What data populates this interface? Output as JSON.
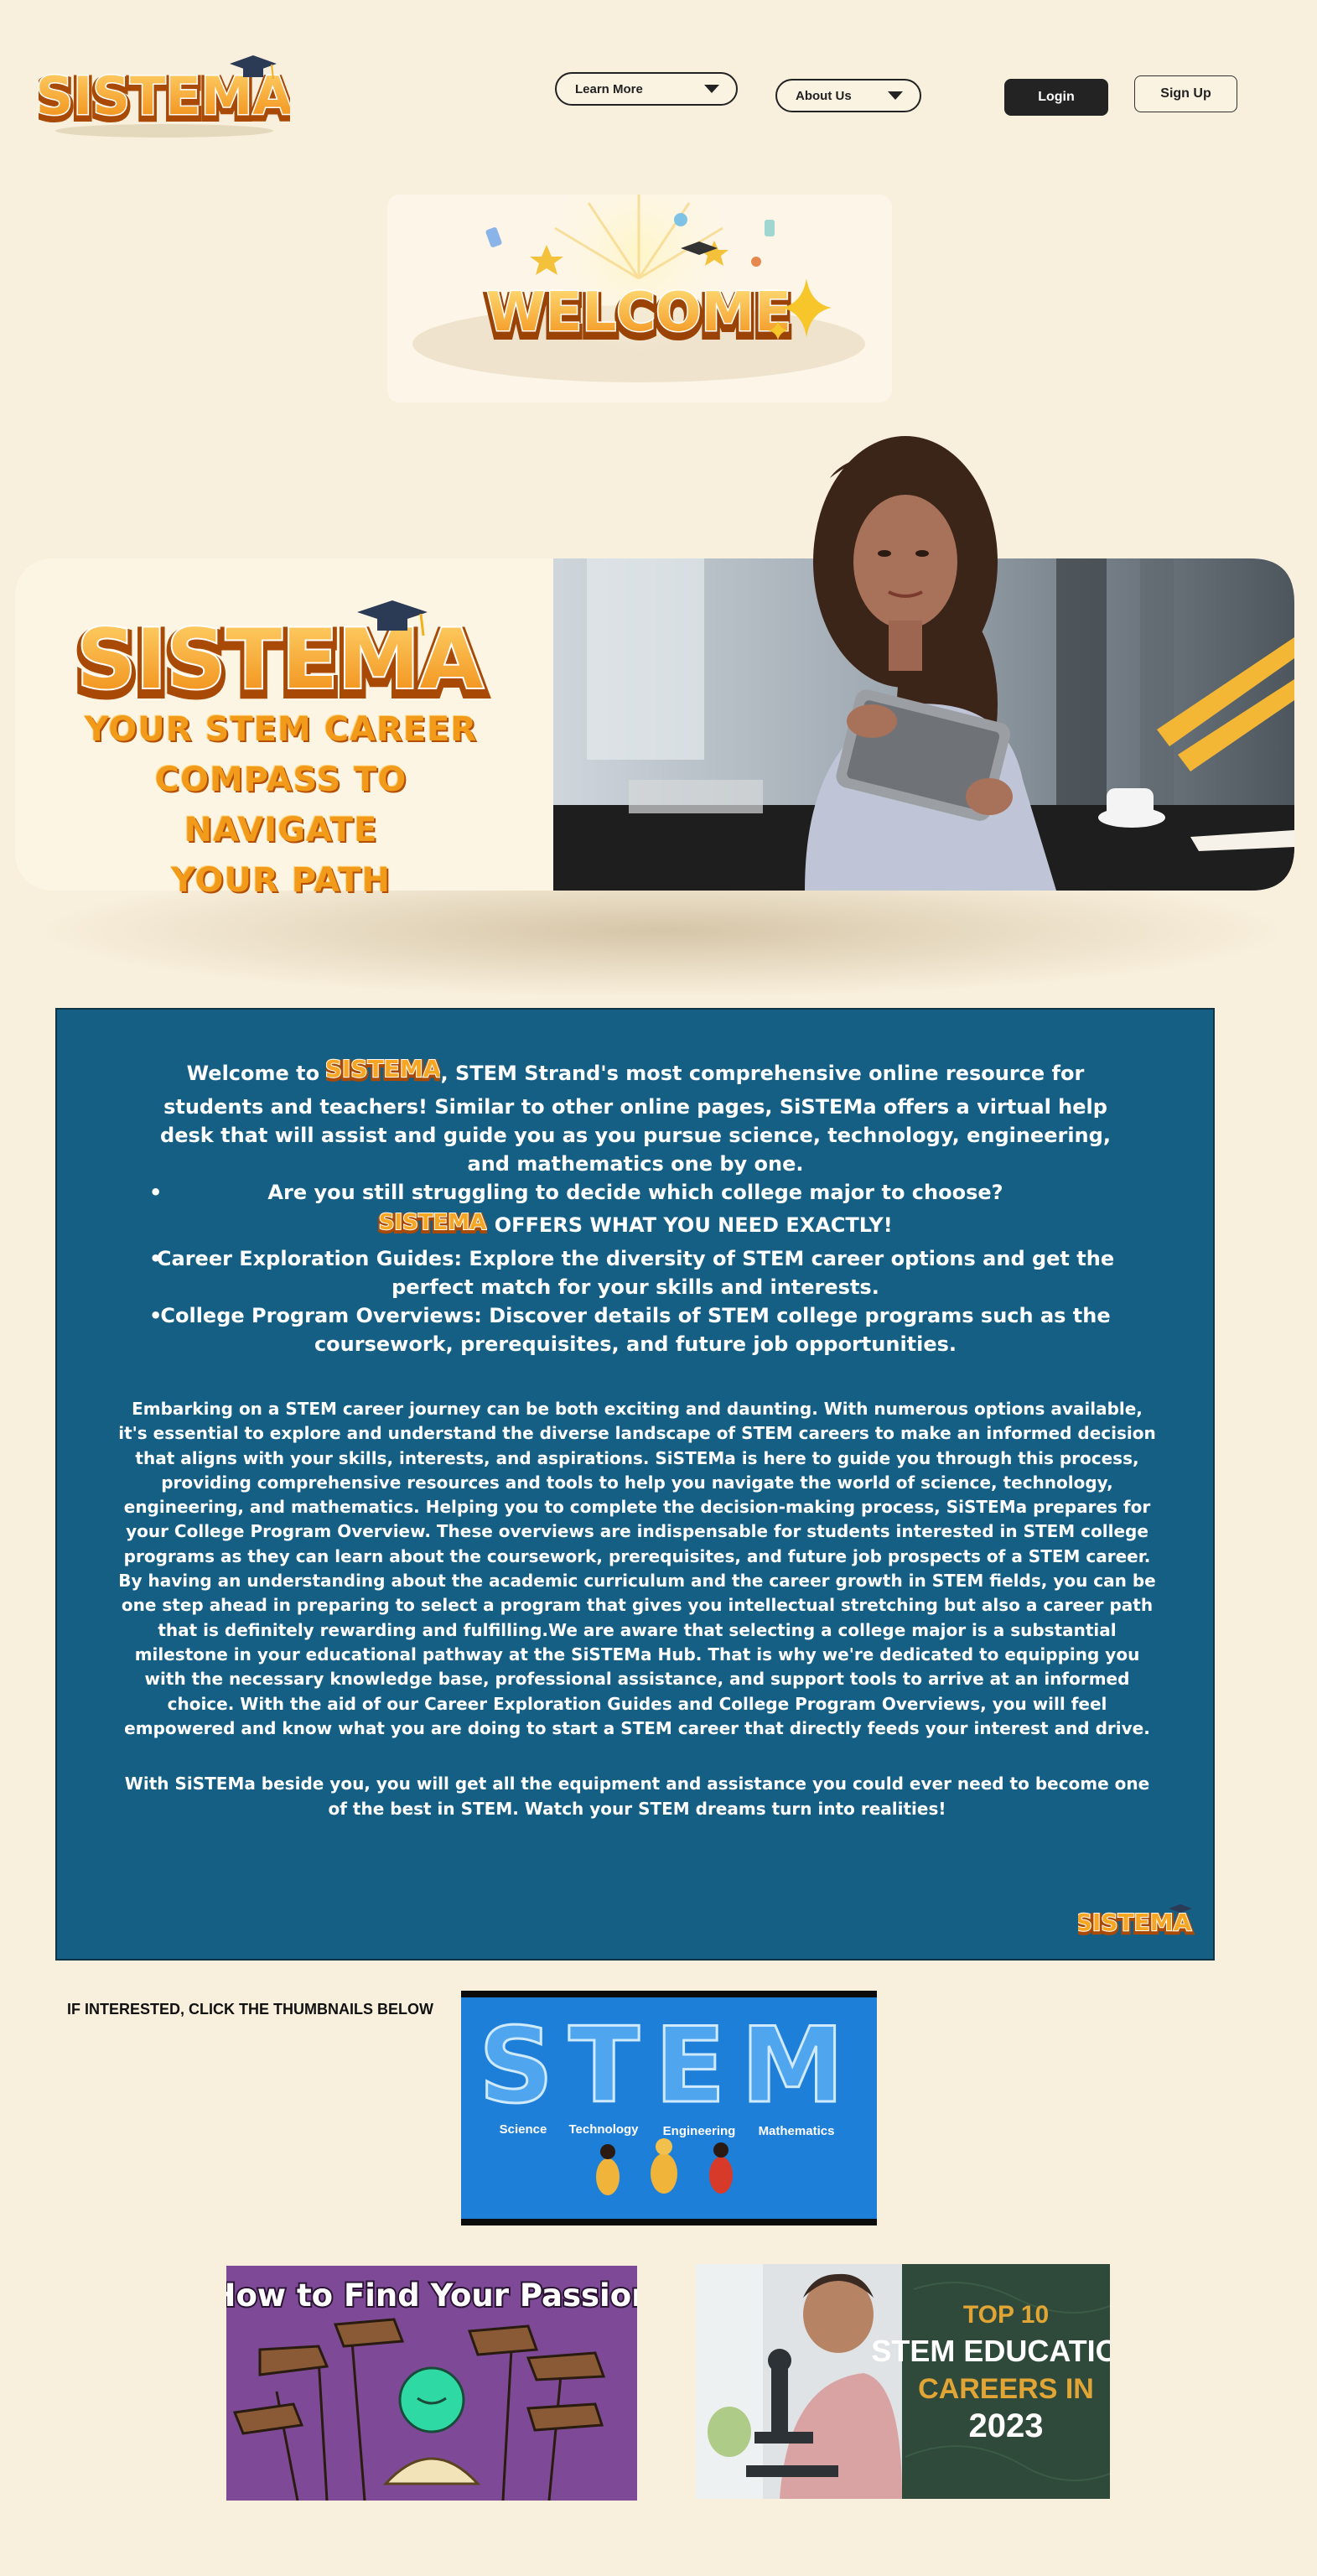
{
  "header": {
    "logo_text": "SISTEMA",
    "nav": [
      {
        "label": "Learn More"
      },
      {
        "label": "About Us"
      }
    ],
    "login_label": "Login",
    "signup_label": "Sign Up"
  },
  "welcome_banner": {
    "text": "WELCOME"
  },
  "hero": {
    "logo_text": "SISTEMA",
    "tagline_lines": [
      "YOUR STEM CAREER",
      "COMPASS TO NAVIGATE",
      "YOUR PATH"
    ]
  },
  "panel": {
    "intro_prefix": "Welcome to",
    "inline_logo_text": "SISTEMA",
    "intro_rest": ", STEM Strand's most comprehensive online resource for students and teachers! Similar to other online pages, SiSTEMa offers a virtual help desk that will assist and guide you as you pursue science, technology, engineering, and mathematics one by one.",
    "question": "Are you still struggling to decide which college major to choose?",
    "offers_text": "OFFERS WHAT YOU NEED EXACTLY!",
    "bullets": [
      "Career Exploration Guides: Explore the diversity of STEM career options and get the perfect match for your skills and interests.",
      "College Program Overviews: Discover details of STEM college programs such as the coursework, prerequisites, and future job opportunities."
    ],
    "body_paragraph_1": "Embarking on a STEM career journey can be both exciting and daunting. With numerous options available, it's essential to explore and understand the diverse landscape of STEM careers to make an informed decision that aligns with your skills, interests, and aspirations. SiSTEMa is here to guide you through this process, providing comprehensive resources and tools to help you navigate the world of science, technology, engineering, and mathematics. Helping you to complete the decision-making process, SiSTEMa prepares for your College Program Overview. These overviews are indispensable for students interested in STEM college programs as they can learn about the coursework, prerequisites, and future job prospects of a STEM career. By having an understanding about the academic curriculum and the career growth in STEM fields, you can be one step ahead in preparing to select a program that gives you intellectual stretching but also a career path that is definitely rewarding and fulfilling.We are aware that selecting a college major is a substantial milestone in your educational pathway at the SiSTEMa Hub. That is why we're dedicated to equipping you with the necessary knowledge base, professional assistance, and support tools to arrive at an informed choice. With the aid of our Career Exploration Guides and College Program Overviews, you will feel empowered and know what you are doing to start a STEM career that directly feeds your interest and drive.",
    "body_paragraph_2": "With SiSTEMa beside you, you will get all the equipment and assistance you could ever need to become one of the best in STEM. Watch your STEM dreams turn into realities!",
    "corner_logo_text": "SISTEMA"
  },
  "thumbnails_section": {
    "note": "IF INTERESTED, CLICK THE THUMBNAILS BELOW",
    "items": [
      {
        "title": "STEM",
        "subtitles": [
          "Science",
          "Technology",
          "Engineering",
          "Mathematics"
        ]
      },
      {
        "title": "How to Find Your Passion"
      },
      {
        "title_lines": [
          "TOP 10",
          "STEM EDUCATION",
          "CAREERS IN",
          "2023"
        ]
      }
    ]
  },
  "colors": {
    "page_bg": "#f8efdc",
    "panel_bg": "#165f84",
    "brand_orange": "#f29a1a",
    "brand_dark_orange": "#b34e05",
    "stem_blue": "#1e7fd8",
    "passion_purple": "#7e4a98",
    "careers_green": "#2f4a3a",
    "careers_gold": "#e0a535"
  },
  "icons": [
    "chevron-down-icon",
    "graduation-cap-icon",
    "sparkle-icon",
    "bullet-icon"
  ]
}
